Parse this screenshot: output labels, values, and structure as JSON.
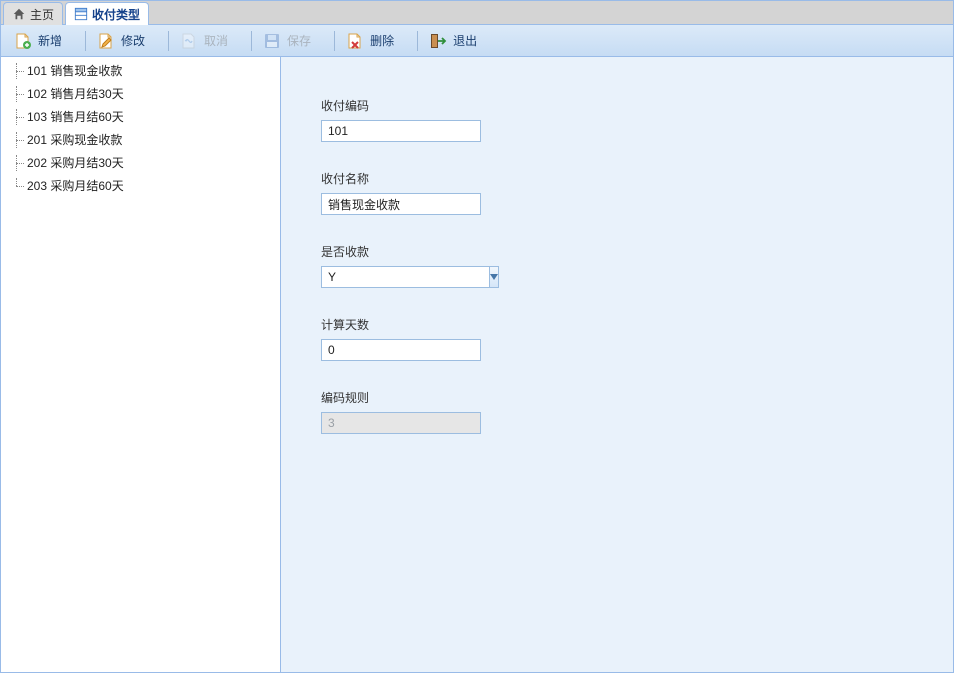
{
  "tabs": [
    {
      "label": "主页",
      "active": false
    },
    {
      "label": "收付类型",
      "active": true
    }
  ],
  "toolbar": {
    "new": "新增",
    "edit": "修改",
    "cancel": "取消",
    "save": "保存",
    "delete": "删除",
    "exit": "退出"
  },
  "tree": {
    "items": [
      {
        "code": "101",
        "name": "销售现金收款"
      },
      {
        "code": "102",
        "name": "销售月结30天"
      },
      {
        "code": "103",
        "name": "销售月结60天"
      },
      {
        "code": "201",
        "name": "采购现金收款"
      },
      {
        "code": "202",
        "name": "采购月结30天"
      },
      {
        "code": "203",
        "name": "采购月结60天"
      }
    ]
  },
  "form": {
    "code_label": "收付编码",
    "code_value": "101",
    "name_label": "收付名称",
    "name_value": "销售现金收款",
    "is_receive_label": "是否收款",
    "is_receive_value": "Y",
    "days_label": "计算天数",
    "days_value": "0",
    "rule_label": "编码规则",
    "rule_value": "3"
  }
}
